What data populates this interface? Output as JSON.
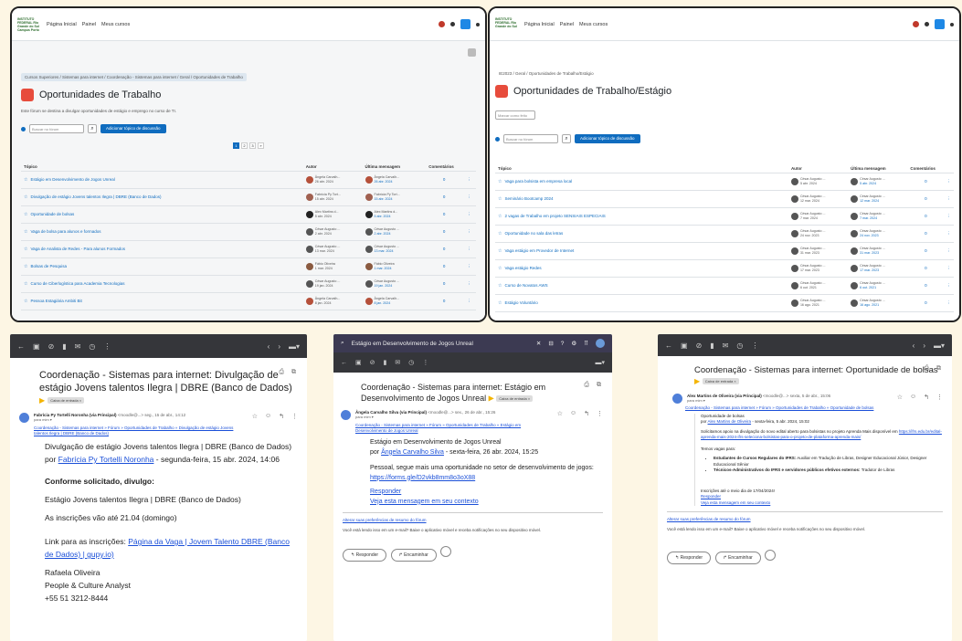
{
  "moodle_left": {
    "logo": "INSTITUTO FEDERAL Rio Grande do Sul Campus Porto Alegre",
    "nav": [
      "Página Inicial",
      "Painel",
      "Meus cursos"
    ],
    "breadcrumb": "Cursos Superiores / Sistemas para internet / Coordenação - Sistemas para internet / Geral / Oportunidades de Trabalho",
    "title": "Oportunidades de Trabalho",
    "description": "Este fórum se destina a divulgar oportunidades de estágio e emprego no curso de TI.",
    "search_placeholder": "Buscar no fórum",
    "add_button": "Adicionar tópico de discussão",
    "pages": [
      "1",
      "2",
      "3",
      "»"
    ],
    "headers": {
      "topic": "Tópico",
      "author": "Autor",
      "last": "Última mensagem",
      "comments": "Comentários"
    },
    "rows": [
      {
        "topic": "Estágio em Desenvolvimento de Jogos Unreal",
        "author": "Ângela Carvalh...",
        "date": "26 abr. 2024",
        "last": "Ângela Carvalh...",
        "last_date": "26 abr. 2024",
        "count": "0",
        "color": "#b5503a"
      },
      {
        "topic": "Divulgação de estágio Jovens talentos Ilegra | DBRE (Banco de Dados)",
        "author": "Fabrícia Py Tort...",
        "date": "15 abr. 2024",
        "last": "Fabrícia Py Tort...",
        "last_date": "15 abr. 2024",
        "count": "0",
        "color": "#a06050"
      },
      {
        "topic": "Oportunidade de bolsas",
        "author": "Alex Martins d...",
        "date": "5 abr. 2024",
        "last": "Alex Martins d...",
        "last_date": "5 abr. 2024",
        "count": "0",
        "color": "#222222"
      },
      {
        "topic": "Vaga de bolsa para alunos e formados",
        "author": "César Augusto ...",
        "date": "2 abr. 2024",
        "last": "César Augusto ...",
        "last_date": "2 abr. 2024",
        "count": "0",
        "color": "#555555"
      },
      {
        "topic": "Vaga de Analista de Redes - Para alunos Formados",
        "author": "César Augusto ...",
        "date": "13 mar. 2024",
        "last": "César Augusto ...",
        "last_date": "13 mar. 2024",
        "count": "0",
        "color": "#555555"
      },
      {
        "topic": "Bolsas de Pesquisa",
        "author": "Fábio Oliveira",
        "date": "1 mar. 2024",
        "last": "Fábio Oliveira",
        "last_date": "1 mar. 2024",
        "count": "0",
        "color": "#8a5a40"
      },
      {
        "topic": "Curso de Ciberlogística para Academia Tecnologias",
        "author": "César Augusto ...",
        "date": "19 jan. 2024",
        "last": "César Augusto ...",
        "last_date": "19 jan. 2024",
        "count": "0",
        "color": "#555555"
      },
      {
        "topic": "Pessoa Estagiária Ambiti Bit",
        "author": "Ângela Carvalh...",
        "date": "8 jan. 2024",
        "last": "Ângela Carvalh...",
        "last_date": "8 jan. 2024",
        "count": "0",
        "color": "#b5503a"
      }
    ]
  },
  "moodle_right": {
    "logo": "INSTITUTO FEDERAL Rio Grande do Sul",
    "nav": [
      "Página Inicial",
      "Painel",
      "Meus cursos"
    ],
    "breadcrumb": "IE2023 / Geral / Oportunidades de Trabalho/Estágio",
    "title": "Oportunidades de Trabalho/Estágio",
    "mark_button": "Marcar como feito",
    "search_placeholder": "Buscar no fórum",
    "add_button": "Adicionar tópico de discussão",
    "headers": {
      "topic": "Tópico",
      "author": "Autor",
      "last": "Última mensagem",
      "comments": "Comentários"
    },
    "rows": [
      {
        "topic": "Vaga para bolsista em empresa local",
        "author": "César Augusto ...",
        "date": "5 abr. 2024",
        "last": "César Augusto ...",
        "last_date": "5 abr. 2024",
        "count": "0"
      },
      {
        "topic": "Seminário Bootcamp 2024",
        "author": "César Augusto ...",
        "date": "12 mar. 2024",
        "last": "César Augusto ...",
        "last_date": "12 mar. 2024",
        "count": "0"
      },
      {
        "topic": "2 vagas de Trabalho em projeto SENSIAIS ESPECIAIS",
        "author": "César Augusto ...",
        "date": "7 mar. 2024",
        "last": "César Augusto ...",
        "last_date": "7 mar. 2024",
        "count": "0"
      },
      {
        "topic": "Oportunidade no sala das letras",
        "author": "César Augusto ...",
        "date": "24 nov. 2023",
        "last": "César Augusto ...",
        "last_date": "24 nov. 2023",
        "count": "0"
      },
      {
        "topic": "Vaga estágio em Provedor de Internet",
        "author": "César Augusto ...",
        "date": "31 mar. 2023",
        "last": "César Augusto ...",
        "last_date": "31 mar. 2023",
        "count": "0"
      },
      {
        "topic": "Vaga estágio Redes",
        "author": "César Augusto ...",
        "date": "17 mar. 2023",
        "last": "César Augusto ...",
        "last_date": "17 mar. 2023",
        "count": "0"
      },
      {
        "topic": "Curso de Novatos AWS",
        "author": "César Augusto ...",
        "date": "6 out. 2021",
        "last": "César Augusto ...",
        "last_date": "6 out. 2021",
        "count": "0"
      },
      {
        "topic": "Estágio Voluntário",
        "author": "César Augusto ...",
        "date": "16 ago. 2021",
        "last": "César Augusto ...",
        "last_date": "16 ago. 2021",
        "count": "0"
      }
    ]
  },
  "email1": {
    "subject": "Coordenação - Sistemas para internet: Divulgação de estágio Jovens talentos Ilegra | DBRE (Banco de Dados)",
    "label": "Caixa de entrada ×",
    "sender": "Fabrícia Py Tortelli Noronha (via Principal)",
    "meta": "<moodle@...>   seg., 15 de abr., 14:12",
    "to": "para mim ▾",
    "breadcrumb": "Coordenação - Sistemas para internet » Fórum » Oportunidades de Trabalho » Divulgação de estágio Jovens talentos Ilegra | DBRE (Banco de Dados)",
    "post_title": "Divulgação de estágio Jovens talentos Ilegra | DBRE (Banco de Dados)",
    "by": "por",
    "author": "Fabrícia Py Tortelli Noronha",
    "date": "- segunda-feira, 15 abr. 2024, 14:06",
    "p1": "Conforme solicitado, divulgo:",
    "p2": "Estágio Jovens talentos Ilegra | DBRE (Banco de Dados)",
    "p3": "As inscrições vão até 21.04 (domingo)",
    "p4": "Link para as inscrições:",
    "link": "Página da Vaga | Jovem Talento DBRE (Banco de Dados) | gupy.io)",
    "sig1": "Rafaela Oliveira",
    "sig2": "People & Culture Analyst",
    "sig3": "+55 51 3212-8444"
  },
  "email2": {
    "tab_title": "Estágio em Desenvolvimento de Jogos Unreal",
    "subject": "Coordenação - Sistemas para internet: Estágio em Desenvolvimento de Jogos Unreal",
    "label": "Caixa de entrada ×",
    "sender": "Ângela Carvalho Silva (via Principal)",
    "meta": "<moodle@...>   sex., 26 de abr., 15:26",
    "to": "para mim ▾",
    "breadcrumb": "Coordenação - Sistemas para internet » Fórum » Oportunidades de Trabalho » Estágio em Desenvolvimento de Jogos Unreal",
    "post_title": "Estágio em Desenvolvimento de Jogos Unreal",
    "by": "por",
    "author": "Ângela Carvalho Silva",
    "date": "- sexta-feira, 26 abr. 2024, 15:25",
    "p1": "Pessoal, segue mais uma oportunidade no setor de desenvolvimento de jogos:",
    "link": "https://forms.gle/D2vkb8mm8o3oX88",
    "reply": "Responder",
    "view": "Veja esta mensagem em seu contexto",
    "prefs": "Alterar suas preferências de resumo do fórum",
    "app": "Você está lendo isso em um e-mail? Baixe o aplicativo móvel e receba notificações no seu dispositivo móvel.",
    "btn_reply": "↰ Responder",
    "btn_forward": "↱ Encaminhar"
  },
  "email3": {
    "subject": "Coordenação - Sistemas para internet: Oportunidade de bolsas",
    "label": "Caixa de entrada ×",
    "sender": "Alex Martins de Oliveira (via Principal)",
    "meta": "<moodle@...>   sexta, 5 de abr., 15:06",
    "to": "para mim ▾",
    "breadcrumb": "Coordenação - Sistemas para internet » Fórum » Oportunidades de Trabalho » Oportunidade de bolsas",
    "post_title": "Oportunidade de bolsas",
    "by": "por",
    "author": "Alex Martins de Oliveira",
    "date": "- sexta-feira, 5 abr. 2024, 15:02",
    "p1": "Solicitamos apoio na divulgação do novo edital aberto para bolsistas no projeto Aprenda Mais disponível em",
    "p1_link": "https://ifrs.edu.br/edital-aprenda-mais-2024-ifrs-seleciona-bolsistas-para-o-projeto-de-plataforma-aprenda-mais/",
    "p2": "Temos vagas para:",
    "b1_strong": "Estudantes de Cursos Regulares do IFRS:",
    "b1": "Auxiliar em Tradução de Libras, Designer Educacional Júnior, Designer Educacional Sênior",
    "b2_strong": "Técnicos-Administrativos do IFRS e servidores públicos efetivos externos:",
    "b2": "Tradutor de Libras",
    "p3": "Inscrições até o meio dia de 17/04/2024!",
    "reply": "Responder",
    "view": "Veja esta mensagem em seu contexto",
    "prefs": "Alterar suas preferências de resumo do fórum",
    "app": "Você está lendo isso em um e-mail? Baixe o aplicativo móvel e receba notificações no seu dispositivo móvel.",
    "btn_reply": "↰ Responder",
    "btn_forward": "↱ Encaminhar"
  },
  "colors": {
    "moodle_blue": "#0f6cbf",
    "background": "#fdf6e4",
    "chrome_dark": "#35363a"
  }
}
